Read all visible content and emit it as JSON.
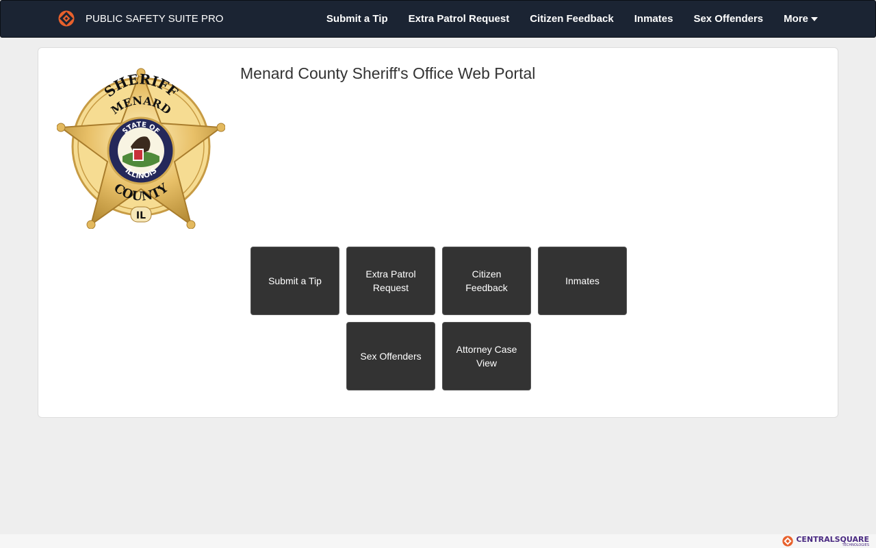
{
  "brand": {
    "name": "PUBLIC SAFETY SUITE PRO",
    "icon": "diamond-logo-icon",
    "accent": "#e8612c"
  },
  "nav": {
    "items": [
      {
        "label": "Submit a Tip"
      },
      {
        "label": "Extra Patrol Request"
      },
      {
        "label": "Citizen Feedback"
      },
      {
        "label": "Inmates"
      },
      {
        "label": "Sex Offenders"
      }
    ],
    "more_label": "More"
  },
  "page": {
    "title": "Menard County Sheriff's Office Web Portal"
  },
  "badge": {
    "top_text": "SHERIFF",
    "county_name": "MENARD",
    "seal_top": "STATE OF",
    "seal_bottom": "ILLINOIS",
    "bottom_text": "COUNTY",
    "state_abbr": "IL"
  },
  "tiles": {
    "row1": [
      {
        "label": "Submit a Tip"
      },
      {
        "label": "Extra Patrol Request"
      },
      {
        "label": "Citizen Feedback"
      },
      {
        "label": "Inmates"
      }
    ],
    "row2": [
      {
        "label": "Sex Offenders"
      },
      {
        "label": "Attorney Case View"
      }
    ]
  },
  "footer": {
    "company": "CENTRALSQUARE",
    "company_sub": "TECHNOLOGIES",
    "color": "#4a2a82"
  },
  "colors": {
    "navbar": "#1b2433",
    "tile": "#333333",
    "background": "#eeeeee"
  }
}
